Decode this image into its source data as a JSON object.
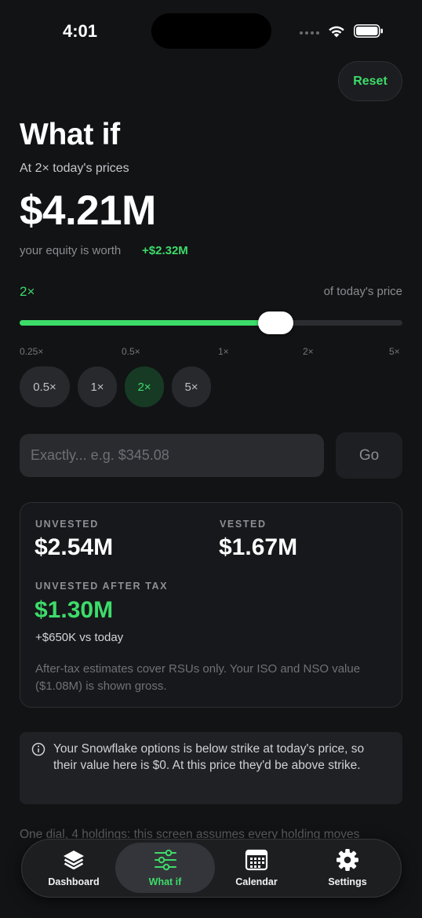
{
  "status_bar": {
    "time": "4:01"
  },
  "header": {
    "reset_label": "Reset",
    "title": "What if"
  },
  "scenario": {
    "subtitle": "At 2× today's prices",
    "equity_value": "$4.21M",
    "worth_label": "your equity is worth",
    "worth_delta": "+$2.32M"
  },
  "slider": {
    "multiplier_label": "2×",
    "unit_label": "of today's price",
    "position_fraction": 0.67,
    "ticks": [
      "0.25×",
      "0.5×",
      "1×",
      "2×",
      "5×"
    ]
  },
  "presets": [
    {
      "label": "0.5×",
      "active": false
    },
    {
      "label": "1×",
      "active": false
    },
    {
      "label": "2×",
      "active": true
    },
    {
      "label": "5×",
      "active": false
    }
  ],
  "exact": {
    "placeholder": "Exactly... e.g. $345.08",
    "go_label": "Go"
  },
  "summary": {
    "unvested_caption": "UNVESTED",
    "unvested_value": "$2.54M",
    "vested_caption": "VESTED",
    "vested_value": "$1.67M",
    "after_tax_caption": "UNVESTED AFTER TAX",
    "after_tax_value": "$1.30M",
    "after_tax_delta": "+$650K vs today",
    "note": "After-tax estimates cover RSUs only. Your ISO and NSO value ($1.08M) is shown gross."
  },
  "info": {
    "icon": "info-icon",
    "text": "Your Snowflake options is below strike at today's price, so their value here is $0. At this price they'd be above strike."
  },
  "footer": {
    "text": "One dial, 4 holdings: this screen assumes every holding moves"
  },
  "tabs": [
    {
      "label": "Dashboard",
      "icon": "stack-icon",
      "active": false
    },
    {
      "label": "What if",
      "icon": "sliders-icon",
      "active": true
    },
    {
      "label": "Calendar",
      "icon": "calendar-icon",
      "active": false
    },
    {
      "label": "Settings",
      "icon": "gear-icon",
      "active": false
    }
  ],
  "colors": {
    "accent": "#3ddc6a",
    "background": "#121315"
  }
}
